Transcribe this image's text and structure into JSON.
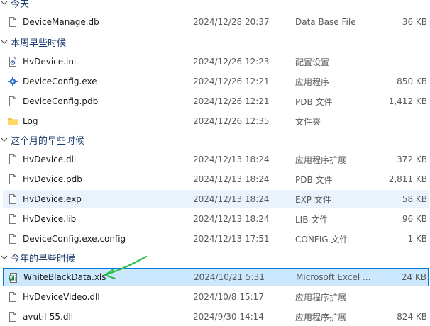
{
  "groups": [
    {
      "label": "今天"
    },
    {
      "label": "本周早些时候"
    },
    {
      "label": "这个月的早些时候"
    },
    {
      "label": "今年的早些时候"
    }
  ],
  "files": [
    {
      "name": "DeviceManage.db",
      "date": "2024/12/28 20:37",
      "type": "Data Base File",
      "size": "36 KB",
      "icon": "file-icon"
    },
    {
      "name": "HvDevice.ini",
      "date": "2024/12/26 12:23",
      "type": "配置设置",
      "size": "",
      "icon": "settings-file-icon"
    },
    {
      "name": "DeviceConfig.exe",
      "date": "2024/12/26 12:21",
      "type": "应用程序",
      "size": "850 KB",
      "icon": "application-icon"
    },
    {
      "name": "DeviceConfig.pdb",
      "date": "2024/12/26 12:21",
      "type": "PDB 文件",
      "size": "1,412 KB",
      "icon": "file-icon"
    },
    {
      "name": "Log",
      "date": "2024/12/26 12:35",
      "type": "文件夹",
      "size": "",
      "icon": "folder-icon"
    },
    {
      "name": "HvDevice.dll",
      "date": "2024/12/13 18:24",
      "type": "应用程序扩展",
      "size": "372 KB",
      "icon": "file-icon"
    },
    {
      "name": "HvDevice.pdb",
      "date": "2024/12/13 18:24",
      "type": "PDB 文件",
      "size": "2,811 KB",
      "icon": "file-icon"
    },
    {
      "name": "HvDevice.exp",
      "date": "2024/12/13 18:24",
      "type": "EXP 文件",
      "size": "58 KB",
      "icon": "file-icon"
    },
    {
      "name": "HvDevice.lib",
      "date": "2024/12/13 18:24",
      "type": "LIB 文件",
      "size": "96 KB",
      "icon": "file-icon"
    },
    {
      "name": "DeviceConfig.exe.config",
      "date": "2024/12/13 17:51",
      "type": "CONFIG 文件",
      "size": "1 KB",
      "icon": "file-icon"
    },
    {
      "name": "WhiteBlackData.xls",
      "date": "2024/10/21 5:31",
      "type": "Microsoft Excel ...",
      "size": "24 KB",
      "icon": "excel-file-icon"
    },
    {
      "name": "HvDeviceVideo.dll",
      "date": "2024/10/8 15:17",
      "type": "应用程序扩展",
      "size": "",
      "icon": "file-icon"
    },
    {
      "name": "avutil-55.dll",
      "date": "2024/9/30 14:14",
      "type": "应用程序扩展",
      "size": "824 KB",
      "icon": "file-icon"
    }
  ],
  "colors": {
    "selection_fill": "#cce8ff",
    "selection_border": "#0078d7",
    "arrow": "#2fbf4a",
    "group_text": "#1f3f6e"
  }
}
